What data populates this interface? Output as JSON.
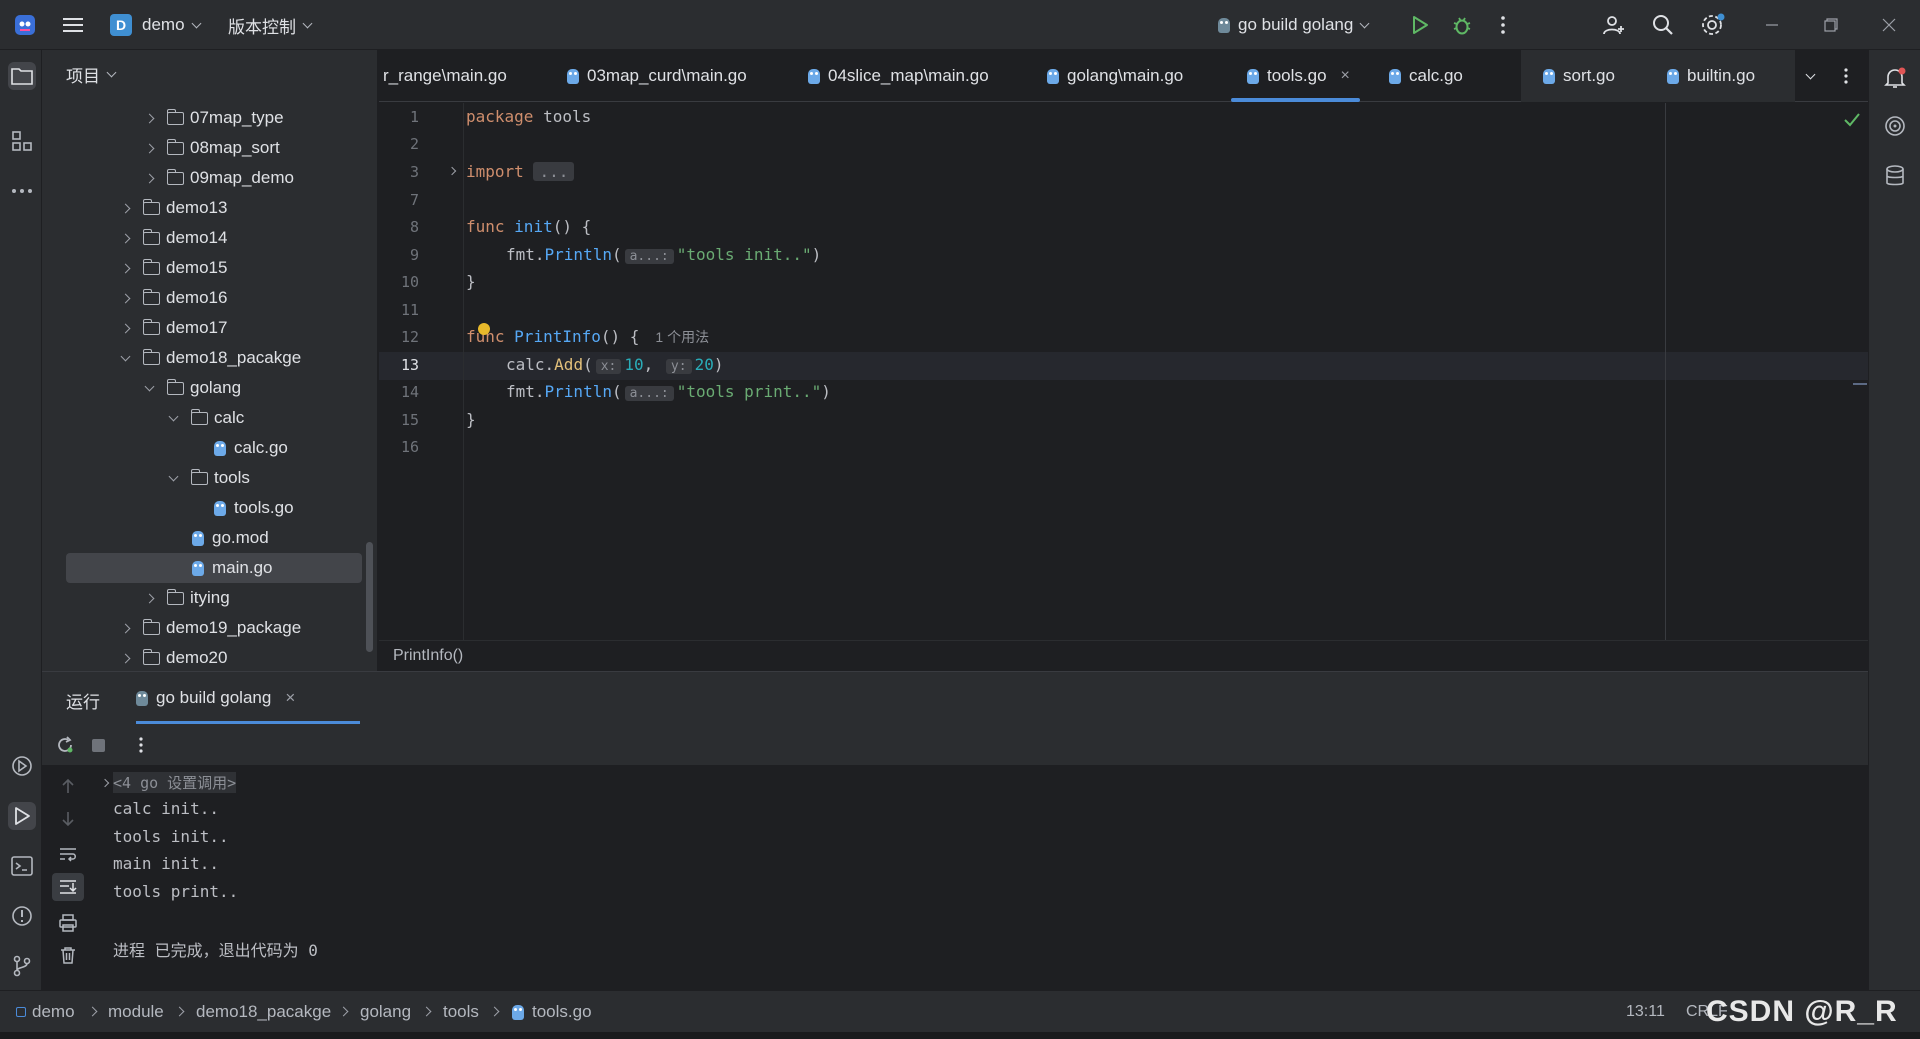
{
  "titlebar": {
    "project_badge": "D",
    "project_name": "demo",
    "vcs_label": "版本控制",
    "run_config": "go build golang"
  },
  "project_panel": {
    "title": "项目",
    "tree": [
      {
        "label": "07map_type",
        "type": "folder",
        "state": "collapsed"
      },
      {
        "label": "08map_sort",
        "type": "folder",
        "state": "collapsed"
      },
      {
        "label": "09map_demo",
        "type": "folder",
        "state": "collapsed"
      },
      {
        "label": "demo13",
        "type": "folder",
        "state": "collapsed"
      },
      {
        "label": "demo14",
        "type": "folder",
        "state": "collapsed"
      },
      {
        "label": "demo15",
        "type": "folder",
        "state": "collapsed"
      },
      {
        "label": "demo16",
        "type": "folder",
        "state": "collapsed"
      },
      {
        "label": "demo17",
        "type": "folder",
        "state": "collapsed"
      },
      {
        "label": "demo18_pacakge",
        "type": "folder",
        "state": "expanded"
      },
      {
        "label": "golang",
        "type": "folder",
        "state": "expanded"
      },
      {
        "label": "calc",
        "type": "folder",
        "state": "expanded"
      },
      {
        "label": "calc.go",
        "type": "file"
      },
      {
        "label": "tools",
        "type": "folder",
        "state": "expanded"
      },
      {
        "label": "tools.go",
        "type": "file"
      },
      {
        "label": "go.mod",
        "type": "file"
      },
      {
        "label": "main.go",
        "type": "file",
        "selected": true
      },
      {
        "label": "itying",
        "type": "folder",
        "state": "collapsed"
      },
      {
        "label": "demo19_package",
        "type": "folder",
        "state": "collapsed"
      },
      {
        "label": "demo20",
        "type": "folder",
        "state": "collapsed"
      }
    ]
  },
  "tabs": [
    {
      "label": "r_range\\main.go"
    },
    {
      "label": "03map_curd\\main.go"
    },
    {
      "label": "04slice_map\\main.go"
    },
    {
      "label": "golang\\main.go"
    },
    {
      "label": "tools.go",
      "active": true,
      "close": "×"
    },
    {
      "label": "calc.go"
    },
    {
      "label": "sort.go"
    },
    {
      "label": "builtin.go"
    }
  ],
  "editor": {
    "line_numbers": [
      "1",
      "2",
      "3",
      "7",
      "8",
      "9",
      "10",
      "11",
      "12",
      "13",
      "14",
      "15",
      "16"
    ],
    "current_line": "13",
    "code": {
      "l1_kw": "package",
      "l1_name": " tools",
      "l3_kw": "import",
      "l3_fold": "...",
      "l8_kw": "func",
      "l8_fn": "init",
      "l8_rest": "() {",
      "l9_pkg": "fmt.",
      "l9_fn": "Println",
      "l9_open": "(",
      "l9_hint": "a...:",
      "l9_str": "\"tools init..\"",
      "l9_close": ")",
      "l10": "}",
      "l12_kw": "func",
      "l12_fn": "PrintInfo",
      "l12_rest": "() {",
      "l12_usage": "1 个用法",
      "l13_pkg": "calc.",
      "l13_fn": "Add",
      "l13_open": "(",
      "l13_hint_x": "x:",
      "l13_x": "10",
      "l13_comma": ", ",
      "l13_hint_y": "y:",
      "l13_y": "20",
      "l13_close": ")",
      "l14_pkg": "fmt.",
      "l14_fn": "Println",
      "l14_open": "(",
      "l14_hint": "a...:",
      "l14_str": "\"tools print..\"",
      "l14_close": ")",
      "l15": "}"
    },
    "breadcrumb": "PrintInfo()"
  },
  "run_panel": {
    "title": "运行",
    "tab_label": "go build golang",
    "tab_close": "×",
    "output": [
      "<4 go 设置调用>",
      "calc init..",
      "tools init..",
      "main init..",
      "tools print..",
      "",
      "进程 已完成，退出代码为 0"
    ]
  },
  "status_bar": {
    "breadcrumbs": [
      "demo",
      "module",
      "demo18_pacakge",
      "golang",
      "tools",
      "tools.go"
    ],
    "position": "13:11",
    "line_sep": "CRLF",
    "watermark": "CSDN @R_R"
  },
  "colors": {
    "accent": "#4b8bd9",
    "run_green": "#5fb865",
    "keyword": "#cf8e6d",
    "function": "#56a8f5",
    "string": "#6aab73",
    "number": "#2aacb8"
  }
}
